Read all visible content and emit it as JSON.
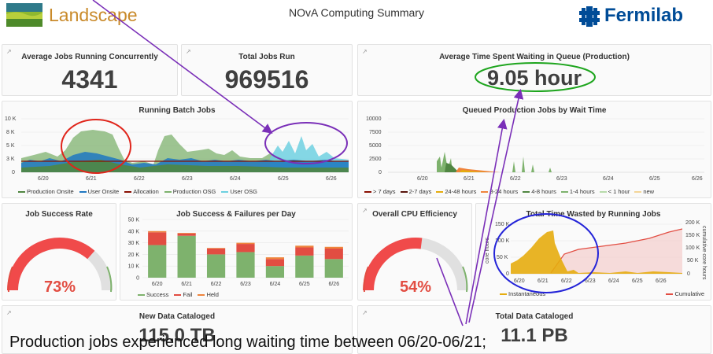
{
  "header": {
    "logo_text": "Landscape",
    "title": "NOvA Computing Summary",
    "brand_text": "Fermilab"
  },
  "stats": {
    "avg_jobs_title": "Average Jobs Running Concurrently",
    "avg_jobs_value": "4341",
    "total_jobs_title": "Total Jobs Run",
    "total_jobs_value": "969516",
    "queue_title": "Average Time Spent Waiting in Queue (Production)",
    "queue_value": "9.05 hour",
    "new_data_title": "New Data Cataloged",
    "new_data_value": "115.0 TB",
    "total_data_title": "Total Data Cataloged",
    "total_data_value": "11.1 PB"
  },
  "colors": {
    "production_onsite": "#508642",
    "user_onsite": "#1f78c1",
    "allocation": "#890f02",
    "production_osg": "#7eb26d",
    "user_osg": "#6ed0e0",
    "success": "#7eb26d",
    "fail": "#e24d42",
    "held": "#ef843c",
    "instantaneous": "#e5ac0e",
    "cumulative": "#e24d42",
    "annot_red": "#e0251b",
    "annot_purple": "#7a2fb8",
    "annot_green": "#1ea51e",
    "annot_blue": "#2424d8",
    "arrow": "#7a2fb8"
  },
  "running_batch": {
    "title": "Running Batch Jobs",
    "y_ticks": [
      "10 K",
      "8 K",
      "5 K",
      "3 K",
      "0"
    ],
    "x_ticks": [
      "6/20",
      "6/21",
      "6/22",
      "6/23",
      "6/24",
      "6/25",
      "6/26"
    ],
    "legend": [
      "Production Onsite",
      "User Onsite",
      "Allocation",
      "Production OSG",
      "User OSG"
    ]
  },
  "queued": {
    "title": "Queued Production Jobs by Wait Time",
    "y_ticks": [
      "10000",
      "7500",
      "5000",
      "2500",
      "0"
    ],
    "x_ticks": [
      "6/20",
      "6/21",
      "6/22",
      "6/23",
      "6/24",
      "6/25",
      "6/26"
    ],
    "legend": [
      {
        "label": "> 7 days",
        "color": "#890f02"
      },
      {
        "label": "2-7 days",
        "color": "#58140c"
      },
      {
        "label": "24-48 hours",
        "color": "#e5ac0e"
      },
      {
        "label": "8-24 hours",
        "color": "#ef843c"
      },
      {
        "label": "4-8 hours",
        "color": "#508642"
      },
      {
        "label": "1-4 hours",
        "color": "#7eb26d"
      },
      {
        "label": "< 1 hour",
        "color": "#b7dbab"
      },
      {
        "label": "new",
        "color": "#f4d598"
      }
    ]
  },
  "job_success_rate": {
    "title": "Job Success Rate",
    "value": "73%",
    "fraction": 0.73
  },
  "success_failures": {
    "title": "Job Success & Failures per Day",
    "y_ticks": [
      "50 K",
      "40 K",
      "30 K",
      "20 K",
      "10 K",
      "0"
    ],
    "legend": [
      "Success",
      "Fail",
      "Held"
    ]
  },
  "cpu_eff": {
    "title": "Overall CPU Efficiency",
    "value": "54%",
    "fraction": 0.54
  },
  "time_wasted": {
    "title": "Total Time Wasted by Running Jobs",
    "y_left_label": "core hours",
    "y_right_label": "cumulative core hours",
    "y_left_ticks": [
      "150 K",
      "100 K",
      "50 K",
      "0"
    ],
    "y_right_ticks": [
      "200 K",
      "150 K",
      "100 K",
      "50 K",
      "0"
    ],
    "x_ticks": [
      "6/20",
      "6/21",
      "6/22",
      "6/23",
      "6/24",
      "6/25",
      "6/26"
    ],
    "legend_left": "Instantaneous",
    "legend_right": "Cumulative"
  },
  "caption": "Production jobs experienced long waiting time between 06/20-06/21;",
  "chart_data": [
    {
      "type": "area",
      "title": "Running Batch Jobs",
      "categories": [
        "6/20",
        "6/21",
        "6/22",
        "6/23",
        "6/24",
        "6/25",
        "6/26"
      ],
      "ylim": [
        0,
        10000
      ],
      "series": [
        {
          "name": "Production Onsite",
          "values": [
            1500,
            2500,
            1000,
            2000,
            1500,
            1500,
            1500
          ]
        },
        {
          "name": "User Onsite",
          "values": [
            2000,
            2500,
            1500,
            2000,
            2500,
            2500,
            2000
          ]
        },
        {
          "name": "Allocation",
          "values": [
            2600,
            2600,
            2600,
            2600,
            2600,
            2600,
            2600
          ]
        },
        {
          "name": "Production OSG",
          "values": [
            1500,
            4000,
            500,
            3500,
            2500,
            500,
            500
          ]
        },
        {
          "name": "User OSG",
          "values": [
            500,
            500,
            500,
            500,
            500,
            3500,
            1000
          ]
        }
      ]
    },
    {
      "type": "bar",
      "title": "Job Success & Failures per Day",
      "categories": [
        "6/20",
        "6/21",
        "6/22",
        "6/23",
        "6/24",
        "6/25",
        "6/26"
      ],
      "ylim": [
        0,
        50000
      ],
      "series": [
        {
          "name": "Success",
          "values": [
            28000,
            36000,
            20000,
            22000,
            10000,
            19000,
            16000
          ]
        },
        {
          "name": "Fail",
          "values": [
            11000,
            2000,
            5000,
            7000,
            6000,
            7000,
            9000
          ]
        },
        {
          "name": "Held",
          "values": [
            1000,
            500,
            500,
            1000,
            1500,
            1500,
            1500
          ]
        }
      ]
    },
    {
      "type": "line",
      "title": "Total Time Wasted by Running Jobs",
      "categories": [
        "6/20",
        "6/21",
        "6/22",
        "6/23",
        "6/24",
        "6/25",
        "6/26"
      ],
      "series": [
        {
          "name": "Instantaneous",
          "values": [
            30000,
            110000,
            5000,
            3000,
            5000,
            5000,
            3000
          ]
        },
        {
          "name": "Cumulative",
          "values": [
            0,
            10000,
            110000,
            130000,
            145000,
            160000,
            175000
          ]
        }
      ]
    }
  ]
}
